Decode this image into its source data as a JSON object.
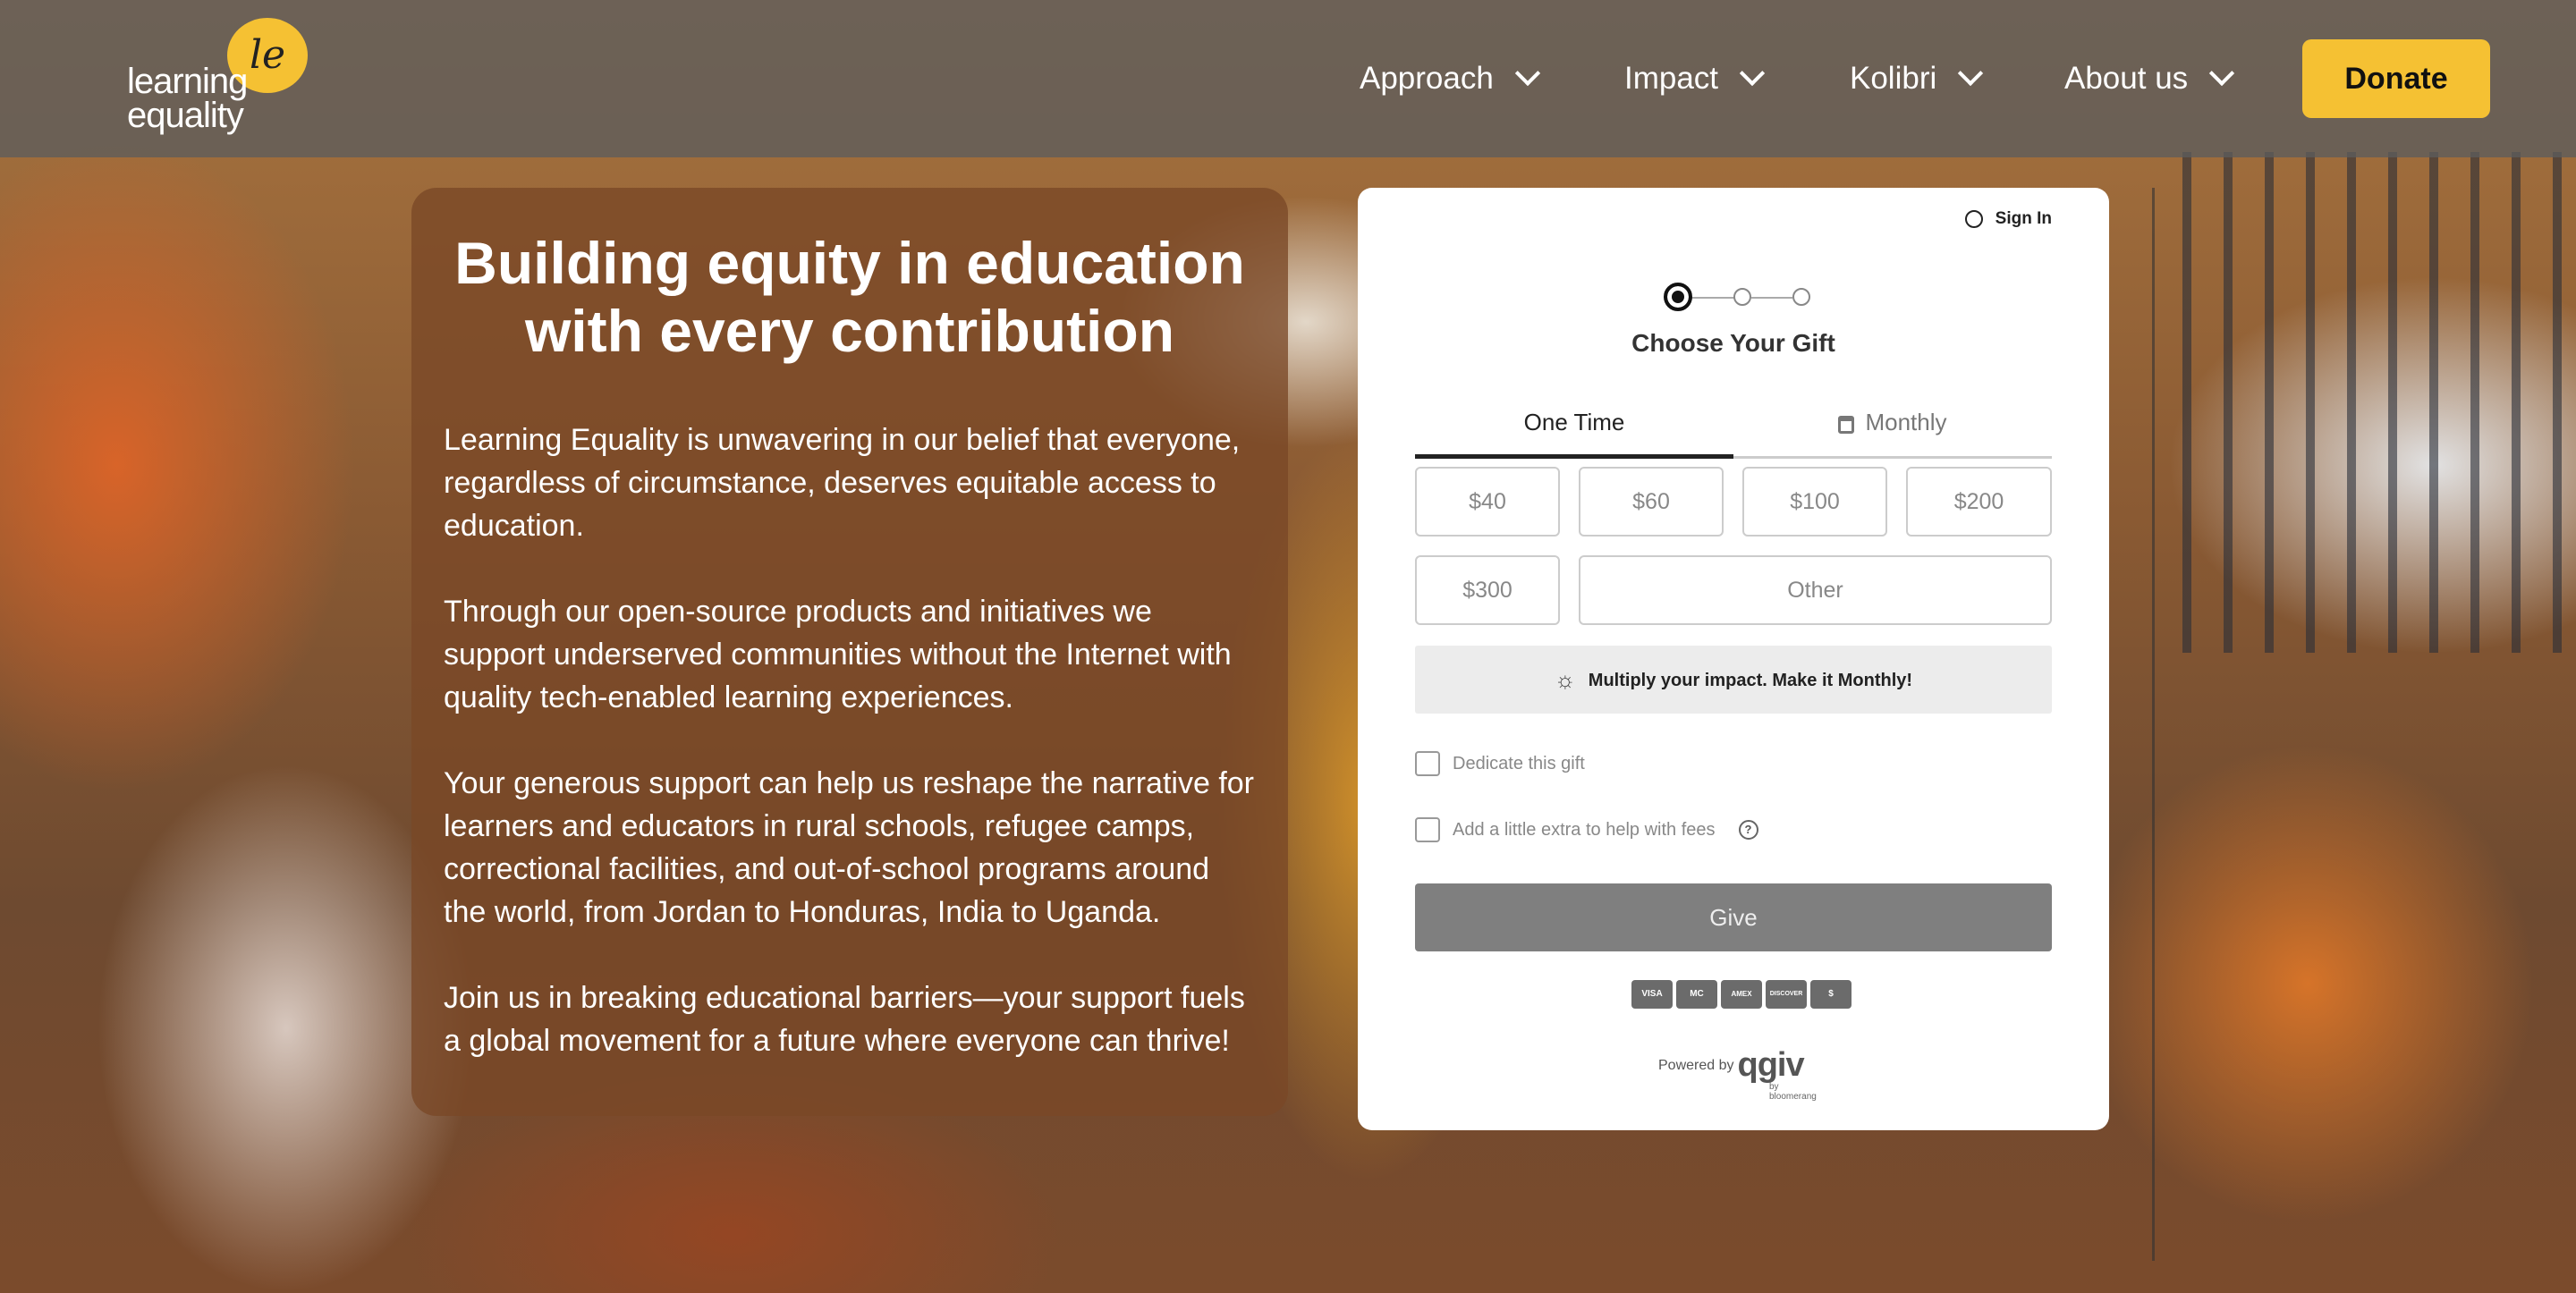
{
  "brand": {
    "logo_mark": "le",
    "logo_line1": "learning",
    "logo_line2": "equality",
    "accent_color": "#f5c133"
  },
  "nav": {
    "items": [
      {
        "label": "Approach"
      },
      {
        "label": "Impact"
      },
      {
        "label": "Kolibri"
      },
      {
        "label": "About us"
      }
    ],
    "donate_label": "Donate"
  },
  "info": {
    "title_line1": "Building equity in education",
    "title_line2": "with every contribution",
    "paragraphs": [
      "Learning Equality is unwavering in our belief that everyone, regardless of circumstance, deserves equitable access to education.",
      "Through our open-source products and initiatives we support underserved communities without the Internet with quality tech-enabled learning experiences.",
      "Your generous support can help us reshape the narrative for learners and educators in rural schools, refugee camps, correctional facilities, and out-of-school programs around the world, from Jordan to Honduras, India to Uganda.",
      "Join us in breaking educational barriers—your support fuels a global movement for a future where everyone can thrive!"
    ]
  },
  "form": {
    "sign_in": "Sign In",
    "step_title": "Choose Your Gift",
    "tabs": [
      {
        "label": "One Time",
        "active": true
      },
      {
        "label": "Monthly",
        "active": false
      }
    ],
    "amounts": [
      "$40",
      "$60",
      "$100",
      "$200",
      "$300"
    ],
    "other_label": "Other",
    "multiply_text": "Multiply your impact. Make it Monthly!",
    "dedicate_label": "Dedicate this gift",
    "fees_label": "Add a little extra to help with fees",
    "give_label": "Give",
    "card_icons": [
      "VISA",
      "MC",
      "AMEX",
      "DISCOVER",
      "$"
    ],
    "powered_by": "Powered by",
    "provider": "qgiv",
    "provider_sub": "by bloomerang"
  }
}
